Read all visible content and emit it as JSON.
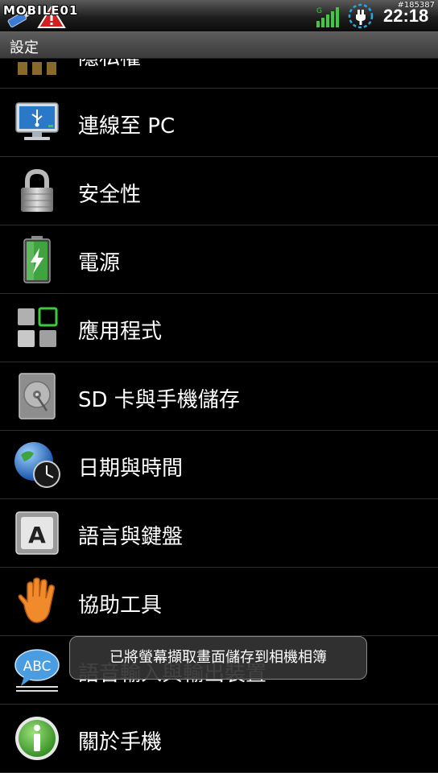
{
  "status_bar": {
    "watermark": "MOBILE01",
    "clock": "22:18",
    "post_id": "#185387",
    "icons": [
      "usb-icon",
      "warning-icon",
      "signal-icon",
      "charging-icon"
    ]
  },
  "title_bar": {
    "title": "設定"
  },
  "settings_list": {
    "partial_item_label": "隱私權",
    "items": [
      {
        "label": "連線至 PC",
        "icon": "monitor-usb-icon"
      },
      {
        "label": "安全性",
        "icon": "padlock-icon"
      },
      {
        "label": "電源",
        "icon": "battery-icon"
      },
      {
        "label": "應用程式",
        "icon": "apps-grid-icon"
      },
      {
        "label": "SD 卡與手機儲存",
        "icon": "hard-drive-icon"
      },
      {
        "label": "日期與時間",
        "icon": "globe-clock-icon"
      },
      {
        "label": "語言與鍵盤",
        "icon": "keyboard-key-icon"
      },
      {
        "label": "協助工具",
        "icon": "hand-icon"
      },
      {
        "label": "語音輸入與輸出裝置",
        "icon": "abc-bubble-icon"
      },
      {
        "label": "關於手機",
        "icon": "info-icon"
      }
    ]
  },
  "toast": {
    "message": "已將螢幕擷取畫面儲存到相機相簿"
  },
  "colors": {
    "background": "#000000",
    "title_bar": "#4a4a4a",
    "divider": "#2e2e2e",
    "toast_bg": "#343434"
  }
}
